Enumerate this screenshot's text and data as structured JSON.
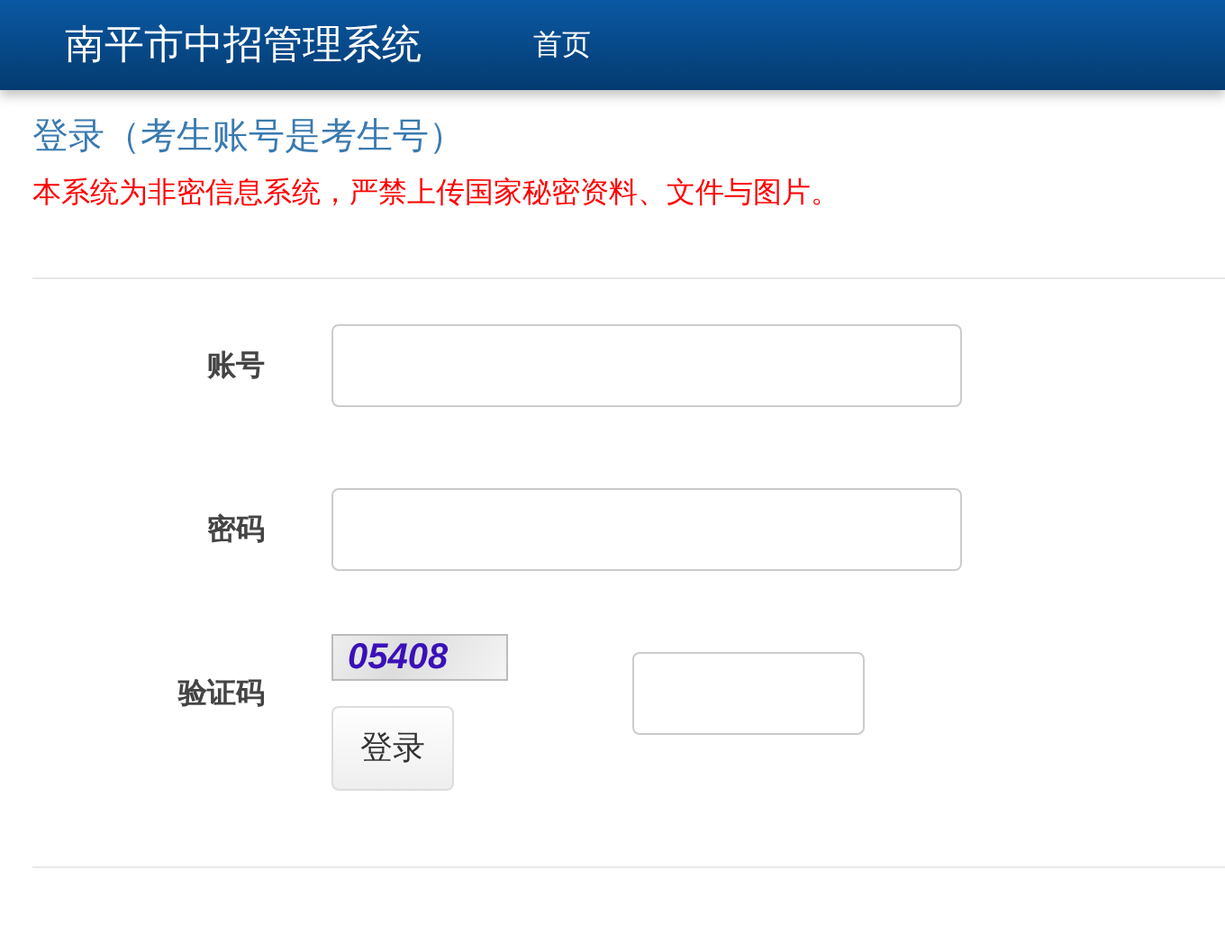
{
  "header": {
    "title": "南平市中招管理系统",
    "nav": [
      {
        "label": "首页"
      }
    ]
  },
  "heading": "登录（考生账号是考生号）",
  "notice": "本系统为非密信息系统，严禁上传国家秘密资料、文件与图片。",
  "form": {
    "fields": [
      {
        "label": "账号",
        "kind": "text"
      },
      {
        "label": "密码",
        "kind": "password"
      },
      {
        "label": "验证码",
        "kind": "captcha",
        "captcha": "05408"
      }
    ],
    "submit": "登录"
  }
}
